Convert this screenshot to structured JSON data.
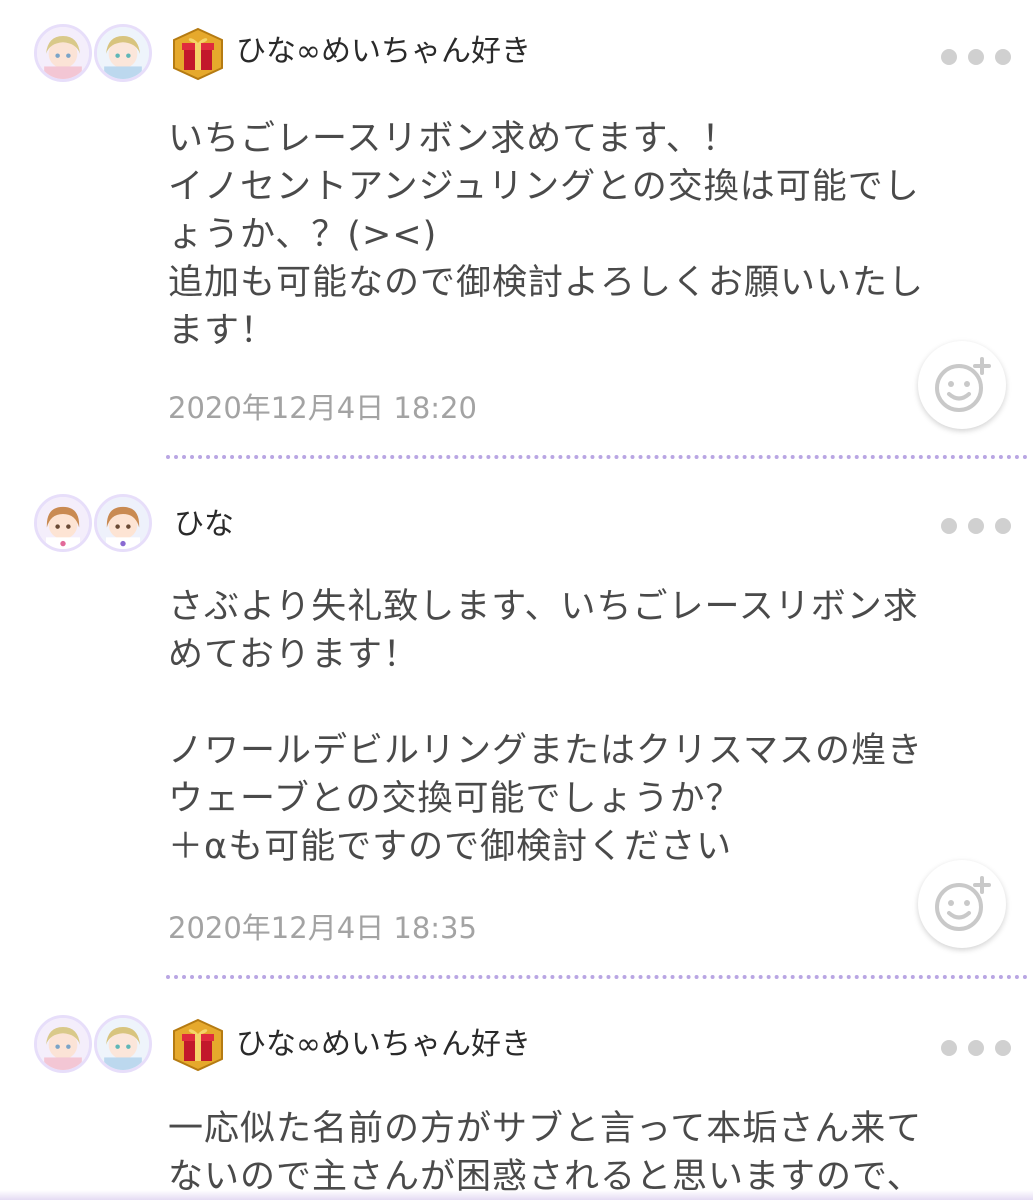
{
  "posts": [
    {
      "username": "ひな∞めいちゃん好き",
      "has_badge": true,
      "badge_icon": "gift-box-icon",
      "body": "いちごレースリボン求めてます、！\nイノセントアンジュリングとの交換は可能でし\nょうか、？(><)\n追加も可能なので御検討よろしくお願いいたし\nます！",
      "timestamp": "2020年12月4日 18:20"
    },
    {
      "username": "ひな",
      "has_badge": false,
      "body": "さぶより失礼致します、いちごレースリボン求\nめております！\n\nノワールデビルリングまたはクリスマスの煌き\nウェーブとの交換可能でしょうか？\n＋αも可能ですので御検討ください",
      "timestamp": "2020年12月4日 18:35"
    },
    {
      "username": "ひな∞めいちゃん好き",
      "has_badge": true,
      "badge_icon": "gift-box-icon",
      "body": "一応似た名前の方がサブと言って本垢さん来て\nないので主さんが困惑されると思いますので、"
    }
  ],
  "icons": {
    "more": "more-dots-icon",
    "reaction": "add-emoji-reaction-icon",
    "avatar": "avatar-icon"
  },
  "colors": {
    "divider": "#b9a6e3",
    "avatar_ring": "#e7defa",
    "timestamp": "#a3a3a3",
    "body_text": "#4a4a4a"
  }
}
